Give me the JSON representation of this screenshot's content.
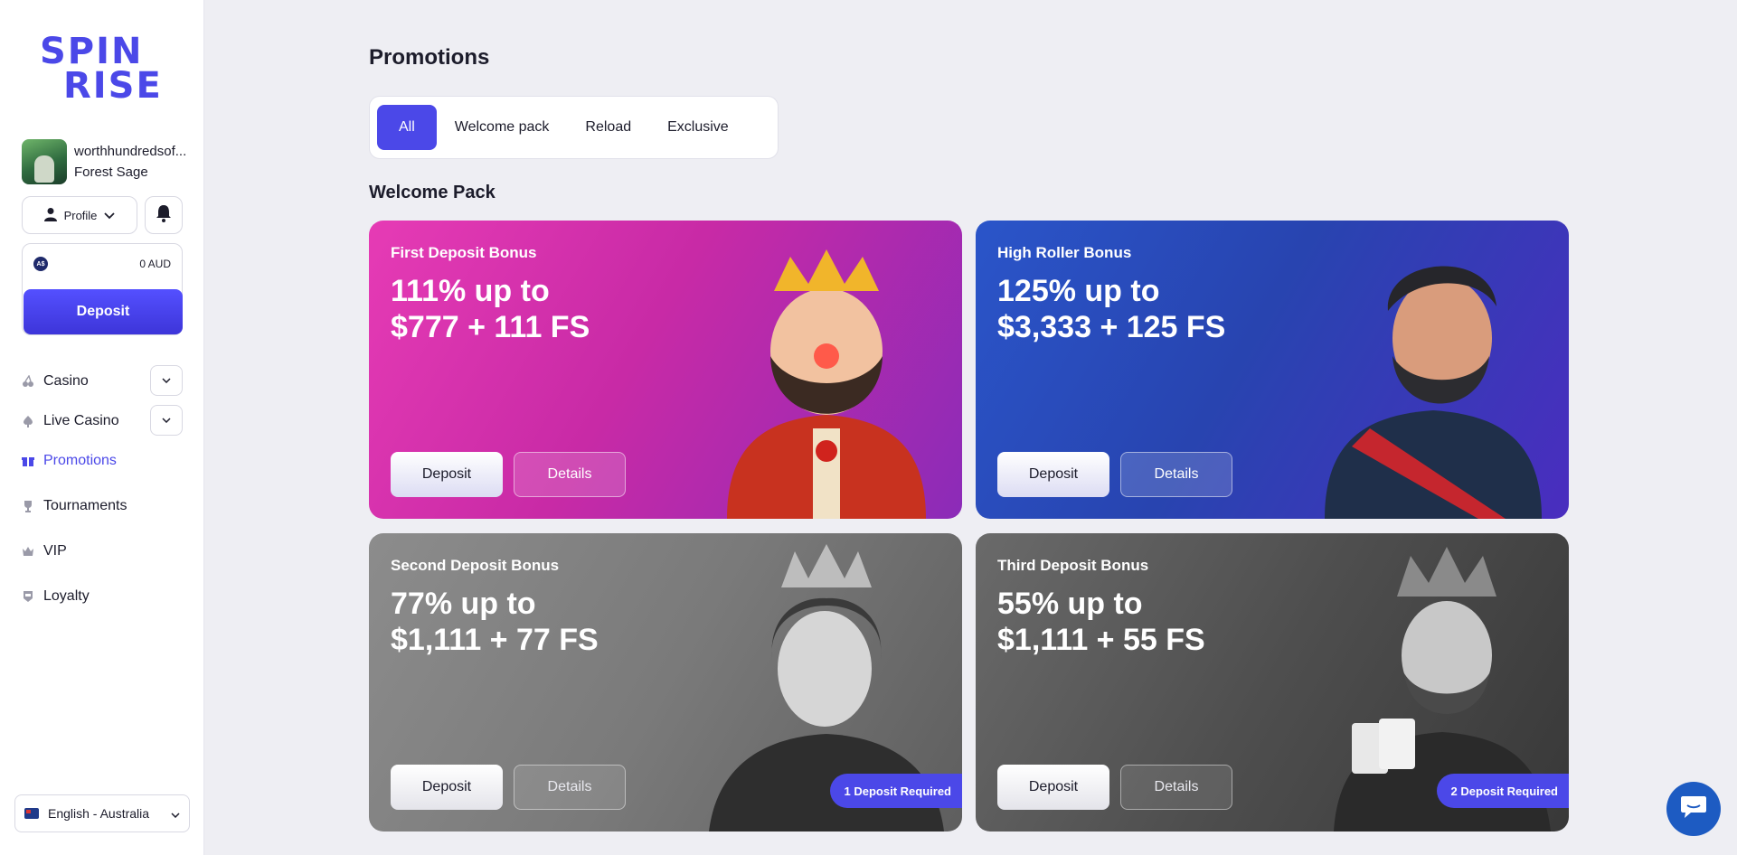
{
  "brand": {
    "logo_line1": "SPIN",
    "logo_line2": "RISE",
    "accent": "#4b48e8"
  },
  "user": {
    "name": "worthhundredsof...",
    "rank": "Forest Sage"
  },
  "profile": {
    "label": "Profile"
  },
  "wallet": {
    "currency_icon": "A$",
    "balance": "0 AUD",
    "deposit_label": "Deposit"
  },
  "nav": {
    "items": [
      {
        "label": "Casino",
        "icon": "cherry-icon"
      },
      {
        "label": "Live Casino",
        "icon": "spade-icon"
      },
      {
        "label": "Promotions",
        "icon": "gift-icon"
      },
      {
        "label": "Tournaments",
        "icon": "trophy-icon"
      },
      {
        "label": "VIP",
        "icon": "crown-icon"
      },
      {
        "label": "Loyalty",
        "icon": "badge-icon"
      }
    ]
  },
  "language": {
    "label": "English - Australia"
  },
  "main": {
    "title": "Promotions",
    "tabs": [
      "All",
      "Welcome pack",
      "Reload",
      "Exclusive"
    ],
    "section_title": "Welcome Pack",
    "cards": [
      {
        "sub": "First Deposit Bonus",
        "line1": "111% up to",
        "line2": "$777 + 111 FS",
        "deposit": "Deposit",
        "details": "Details"
      },
      {
        "sub": "High Roller Bonus",
        "line1": "125% up to",
        "line2": "$3,333 + 125 FS",
        "deposit": "Deposit",
        "details": "Details"
      },
      {
        "sub": "Second Deposit Bonus",
        "line1": "77% up to",
        "line2": "$1,111 + 77 FS",
        "deposit": "Deposit",
        "details": "Details",
        "badge": "1 Deposit Required"
      },
      {
        "sub": "Third Deposit Bonus",
        "line1": "55% up to",
        "line2": "$1,111 + 55 FS",
        "deposit": "Deposit",
        "details": "Details",
        "badge": "2 Deposit Required"
      }
    ]
  }
}
